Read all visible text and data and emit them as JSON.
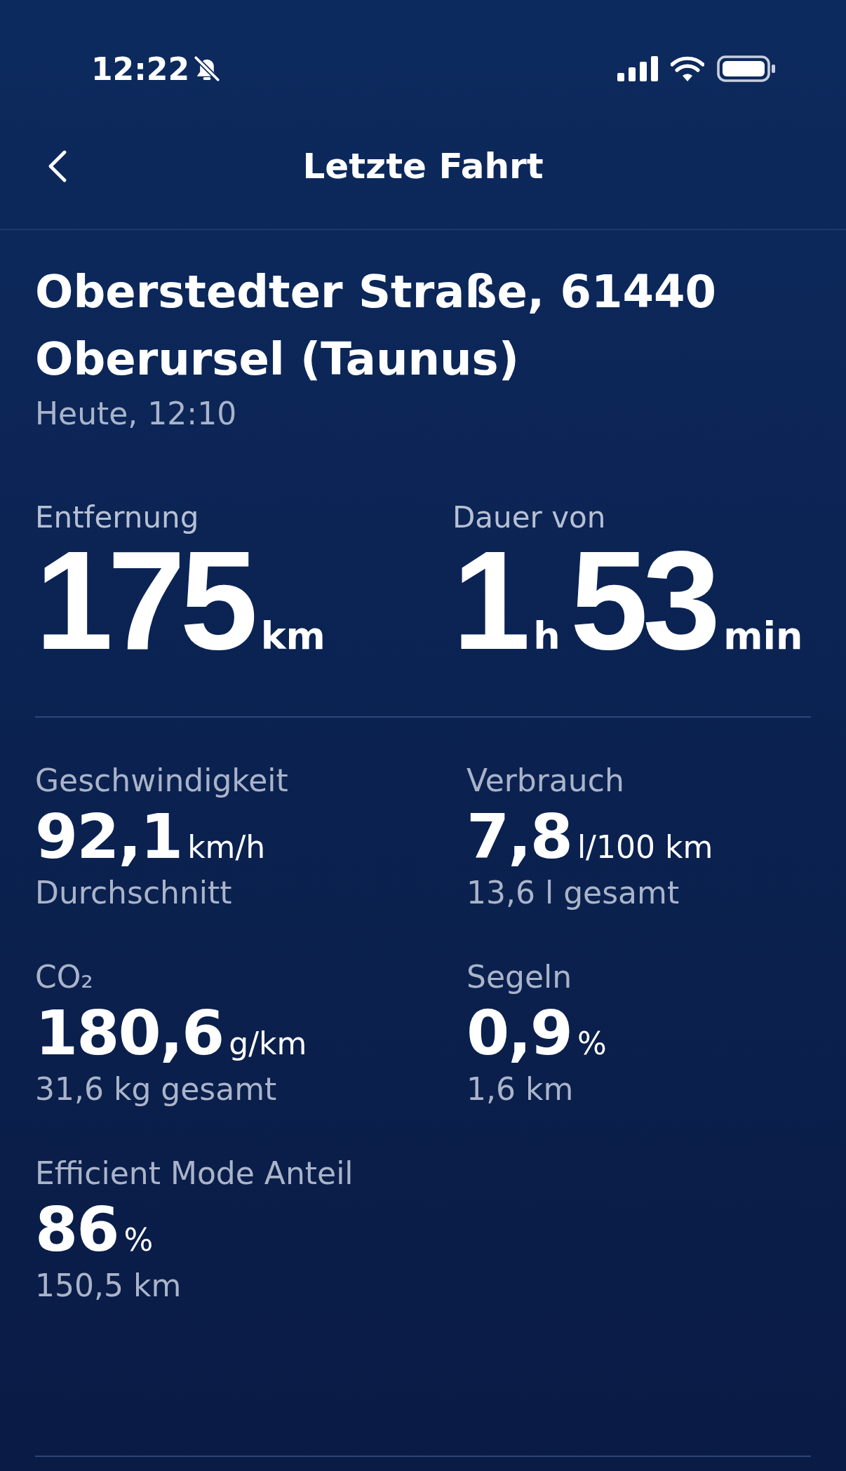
{
  "status_bar": {
    "time": "12:22"
  },
  "header": {
    "title": "Letzte Fahrt"
  },
  "trip": {
    "address": "Oberstedter Straße, 61440 Oberursel (Taunus)",
    "date": "Heute, 12:10"
  },
  "summary": [
    {
      "label": "Entfernung",
      "parts": [
        {
          "value": "175",
          "unit": "km"
        }
      ]
    },
    {
      "label": "Dauer von",
      "parts": [
        {
          "value": "1",
          "unit": "h"
        },
        {
          "value": "53",
          "unit": "min"
        }
      ]
    }
  ],
  "stats": [
    {
      "label": "Geschwindigkeit",
      "value": "92,1",
      "unit": "km/h",
      "note": "Durchschnitt"
    },
    {
      "label": "Verbrauch",
      "value": "7,8",
      "unit": "l/100 km",
      "note": "13,6 l gesamt"
    },
    {
      "label": "CO₂",
      "value": "180,6",
      "unit": "g/km",
      "note": "31,6 kg gesamt"
    },
    {
      "label": "Segeln",
      "value": "0,9",
      "unit": "%",
      "note": "1,6 km"
    },
    {
      "label": "Efficient Mode Anteil",
      "value": "86",
      "unit": "%",
      "note": "150,5 km"
    }
  ]
}
